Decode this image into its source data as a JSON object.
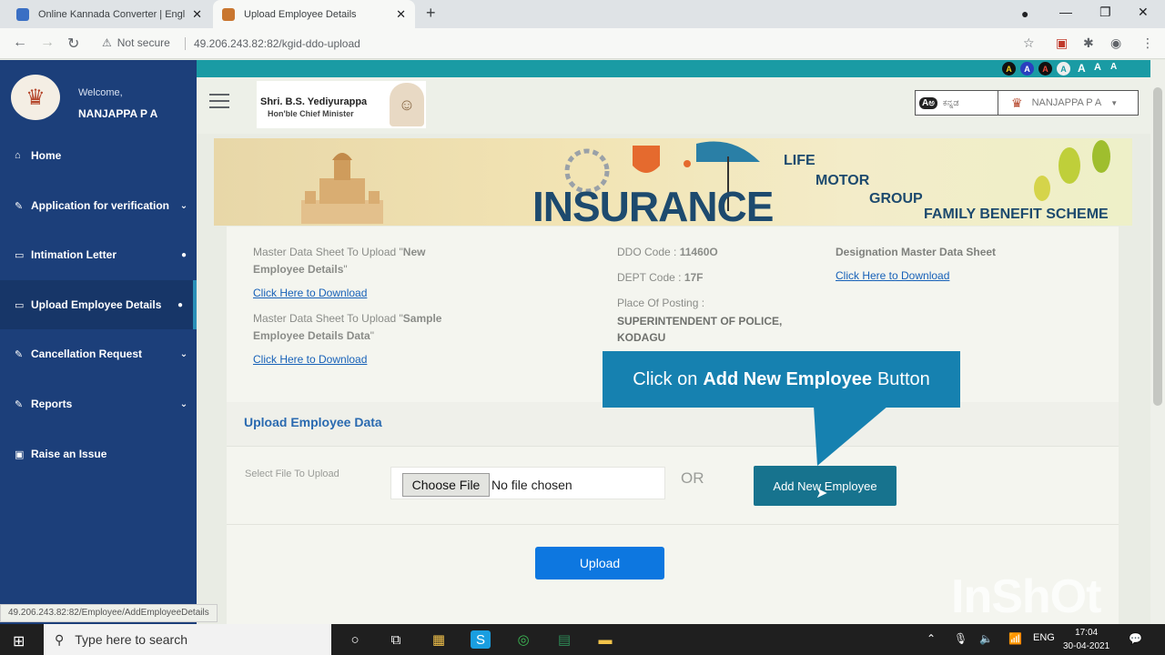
{
  "browser": {
    "tabs": [
      {
        "title": "Online Kannada Converter | Engl",
        "active": false
      },
      {
        "title": "Upload Employee Details",
        "active": true
      }
    ],
    "security_label": "Not secure",
    "url": "49.206.243.82:82/kgid-ddo-upload",
    "status_url": "49.206.243.82:82/Employee/AddEmployeeDetails"
  },
  "sidebar": {
    "welcome": "Welcome,",
    "username": "NANJAPPA P A",
    "items": [
      {
        "label": "Home",
        "icon": "home-icon",
        "right": ""
      },
      {
        "label": "Application for verification",
        "icon": "edit-icon",
        "right": "chevron"
      },
      {
        "label": "Intimation Letter",
        "icon": "monitor-icon",
        "right": "dot"
      },
      {
        "label": "Upload Employee Details",
        "icon": "monitor-icon",
        "right": "dot"
      },
      {
        "label": "Cancellation Request",
        "icon": "edit-icon",
        "right": "chevron"
      },
      {
        "label": "Reports",
        "icon": "edit-icon",
        "right": "chevron"
      },
      {
        "label": "Raise an Issue",
        "icon": "floppy-icon",
        "right": ""
      }
    ]
  },
  "accessibility": {
    "contrast_letters": [
      "A",
      "A",
      "A",
      "A"
    ],
    "font_sizes": [
      "A",
      "A",
      "A"
    ]
  },
  "header": {
    "cm_name": "Shri. B.S. Yediyurappa",
    "cm_title": "Hon'ble Chief Minister",
    "language_label": "ಕನ್ನಡ",
    "user_dropdown": "NANJAPPA P A"
  },
  "banner": {
    "main": "INSURANCE",
    "life": "LIFE",
    "motor": "MOTOR",
    "group": "GROUP",
    "family": "FAMILY BENEFIT SCHEME"
  },
  "info": {
    "new_employee_sheet_prefix": "Master Data Sheet To Upload \"",
    "new_employee_sheet_bold": "New Employee Details",
    "new_employee_sheet_suffix": "\"",
    "download_1": "Click Here to Download",
    "sample_sheet_prefix": "Master Data Sheet To Upload \"",
    "sample_sheet_bold": "Sample Employee Details Data",
    "sample_sheet_suffix": "\"",
    "download_2": "Click Here to Download",
    "ddo_code_label": "DDO Code :",
    "ddo_code_value": "11460O",
    "dept_code_label": "DEPT Code :",
    "dept_code_value": "17F",
    "posting_label": "Place Of Posting :",
    "posting_value_1": "SUPERINTENDENT OF POLICE,",
    "posting_value_2": "KODAGU",
    "designation_sheet": "Designation Master Data Sheet",
    "download_3": "Click Here to Download"
  },
  "upload": {
    "section_title": "Upload Employee Data",
    "select_label": "Select File To Upload",
    "choose_file": "Choose File",
    "no_file": "No file chosen",
    "or": "OR",
    "add_new_employee": "Add New Employee",
    "upload_button": "Upload"
  },
  "callout": {
    "prefix": "Click on",
    "bold": "Add New Employee",
    "suffix": "Button"
  },
  "watermark": "InShOt",
  "taskbar": {
    "search_placeholder": "Type here to search",
    "language": "ENG",
    "time": "17:04",
    "date": "30-04-2021"
  },
  "colors": {
    "sidebar": "#1c3f7a",
    "teal_strip": "#1a9ba4",
    "callout": "#1681b0",
    "add_button": "#17738e",
    "upload_button": "#0d77e0",
    "link": "#1761b8"
  }
}
